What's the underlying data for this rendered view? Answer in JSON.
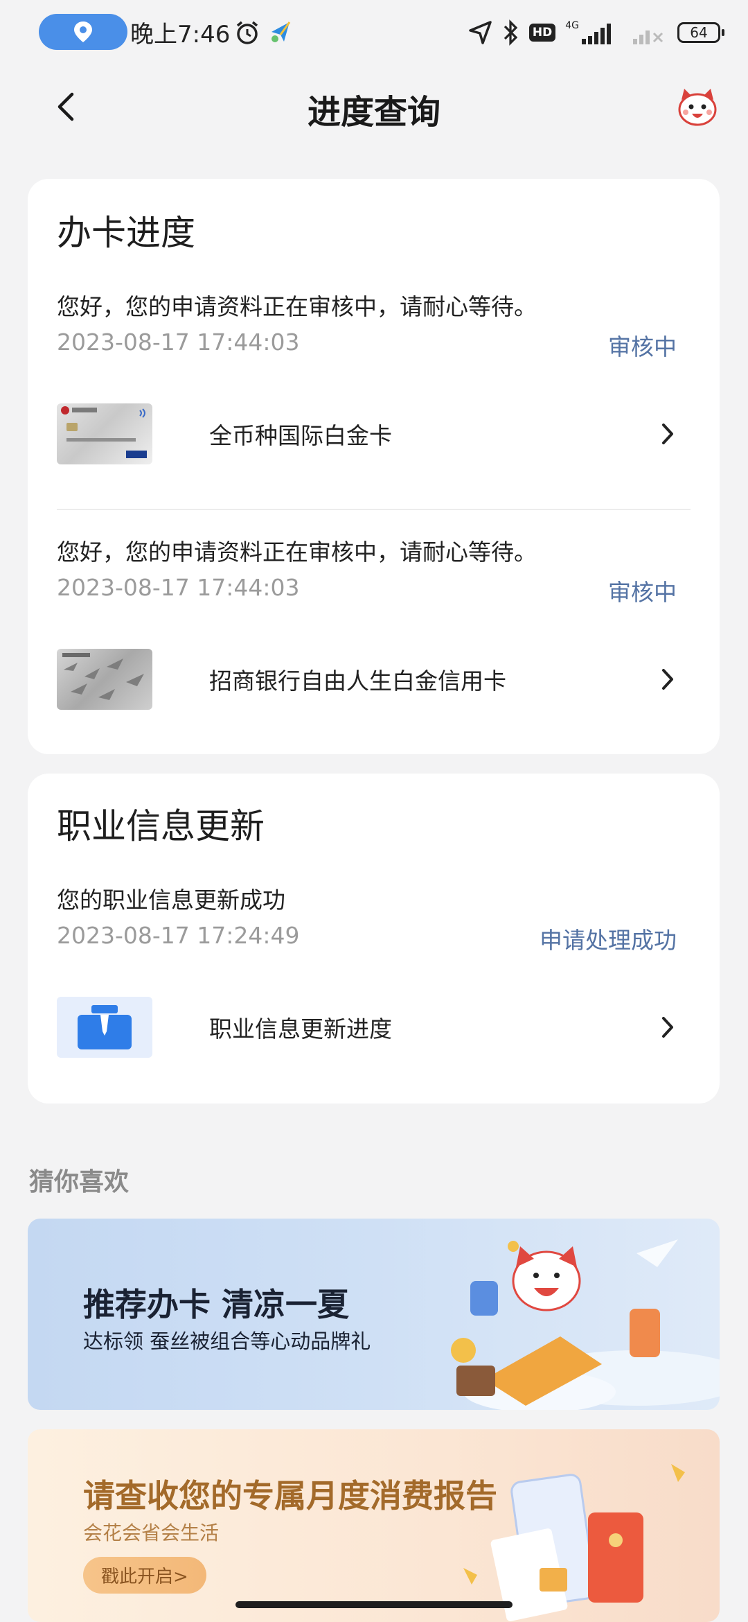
{
  "status_bar": {
    "time": "晚上7:46",
    "network": "4G",
    "hd": "HD",
    "battery": "64"
  },
  "nav": {
    "title": "进度查询"
  },
  "card_progress": {
    "title": "办卡进度",
    "entries": [
      {
        "message": "您好，您的申请资料正在审核中，请耐心等待。",
        "timestamp": "2023-08-17 17:44:03",
        "status": "审核中",
        "card_name": "全币种国际白金卡"
      },
      {
        "message": "您好，您的申请资料正在审核中，请耐心等待。",
        "timestamp": "2023-08-17 17:44:03",
        "status": "审核中",
        "card_name": "招商银行自由人生白金信用卡"
      }
    ]
  },
  "card_job": {
    "title": "职业信息更新",
    "message": "您的职业信息更新成功",
    "timestamp": "2023-08-17 17:24:49",
    "status": "申请处理成功",
    "item_label": "职业信息更新进度"
  },
  "recommend": {
    "heading": "猜你喜欢",
    "banner1": {
      "title": "推荐办卡 清凉一夏",
      "subtitle": "达标领 蚕丝被组合等心动品牌礼"
    },
    "banner2": {
      "title": "请查收您的专属月度消费报告",
      "subtitle": "会花会省会生活",
      "button": "戳此开启>"
    }
  },
  "colors": {
    "accent": "#5473a4",
    "page_bg": "#f3f3f4",
    "location_pill": "#4a8fe8"
  }
}
